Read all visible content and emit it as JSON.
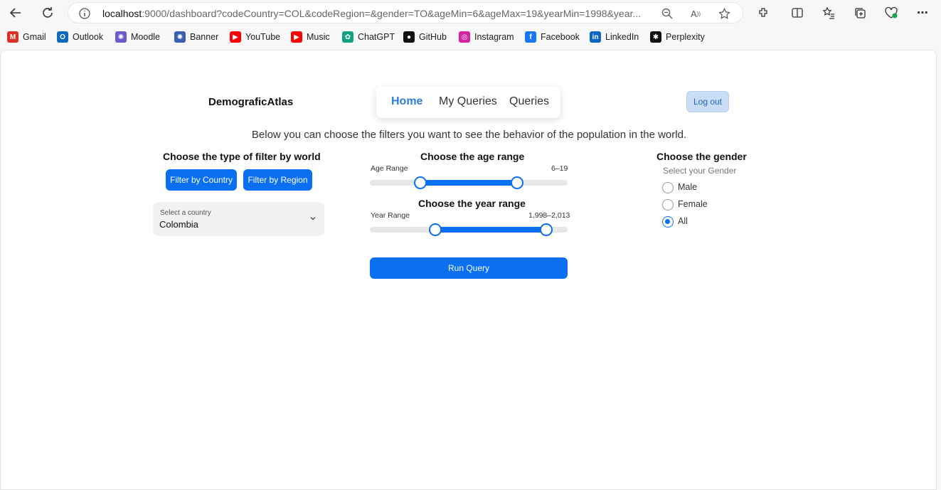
{
  "browser": {
    "url_host": "localhost",
    "url_rest": ":9000/dashboard?codeCountry=COL&codeRegion=&gender=TO&ageMin=6&ageMax=19&yearMin=1998&year...",
    "bookmarks": [
      {
        "label": "Gmail",
        "icon": "gmail-icon",
        "color": "#d93025"
      },
      {
        "label": "Outlook",
        "icon": "outlook-icon",
        "color": "#0f6cbd"
      },
      {
        "label": "Moodle",
        "icon": "moodle-icon",
        "color": "#6a5acd"
      },
      {
        "label": "Banner",
        "icon": "banner-icon",
        "color": "#3a5fb0"
      },
      {
        "label": "YouTube",
        "icon": "youtube-icon",
        "color": "#ff0000"
      },
      {
        "label": "Music",
        "icon": "youtube-music-icon",
        "color": "#ff0000"
      },
      {
        "label": "ChatGPT",
        "icon": "chatgpt-icon",
        "color": "#10a37f"
      },
      {
        "label": "GitHub",
        "icon": "github-icon",
        "color": "#111111"
      },
      {
        "label": "Instagram",
        "icon": "instagram-icon",
        "color": "#d6249f"
      },
      {
        "label": "Facebook",
        "icon": "facebook-icon",
        "color": "#1877f2"
      },
      {
        "label": "LinkedIn",
        "icon": "linkedin-icon",
        "color": "#0a66c2"
      },
      {
        "label": "Perplexity",
        "icon": "perplexity-icon",
        "color": "#111111"
      }
    ]
  },
  "header": {
    "brand": "DemograficAtlas",
    "nav": [
      "Home",
      "My Queries",
      "Queries"
    ],
    "logout": "Log out"
  },
  "intro": "Below you can choose the filters you want to see the behavior of the population in the world.",
  "filter_type": {
    "title": "Choose the type of filter by world",
    "country_btn": "Filter by Country",
    "region_btn": "Filter by Region",
    "select_label": "Select a country",
    "select_value": "Colombia"
  },
  "age": {
    "title": "Choose the age range",
    "label": "Age Range",
    "value_text": "6–19",
    "min": 6,
    "max": 19
  },
  "year": {
    "title": "Choose the year range",
    "label": "Year Range",
    "value_text": "1,998–2,013",
    "min": 1998,
    "max": 2013
  },
  "run_query": "Run Query",
  "gender": {
    "title": "Choose the gender",
    "subtitle": "Select your Gender",
    "options": [
      "Male",
      "Female",
      "All"
    ],
    "selected": "All"
  },
  "colors": {
    "accent": "#0a6ff0",
    "nav_active": "#2a7de1",
    "logout_bg": "#c9ddf6"
  }
}
